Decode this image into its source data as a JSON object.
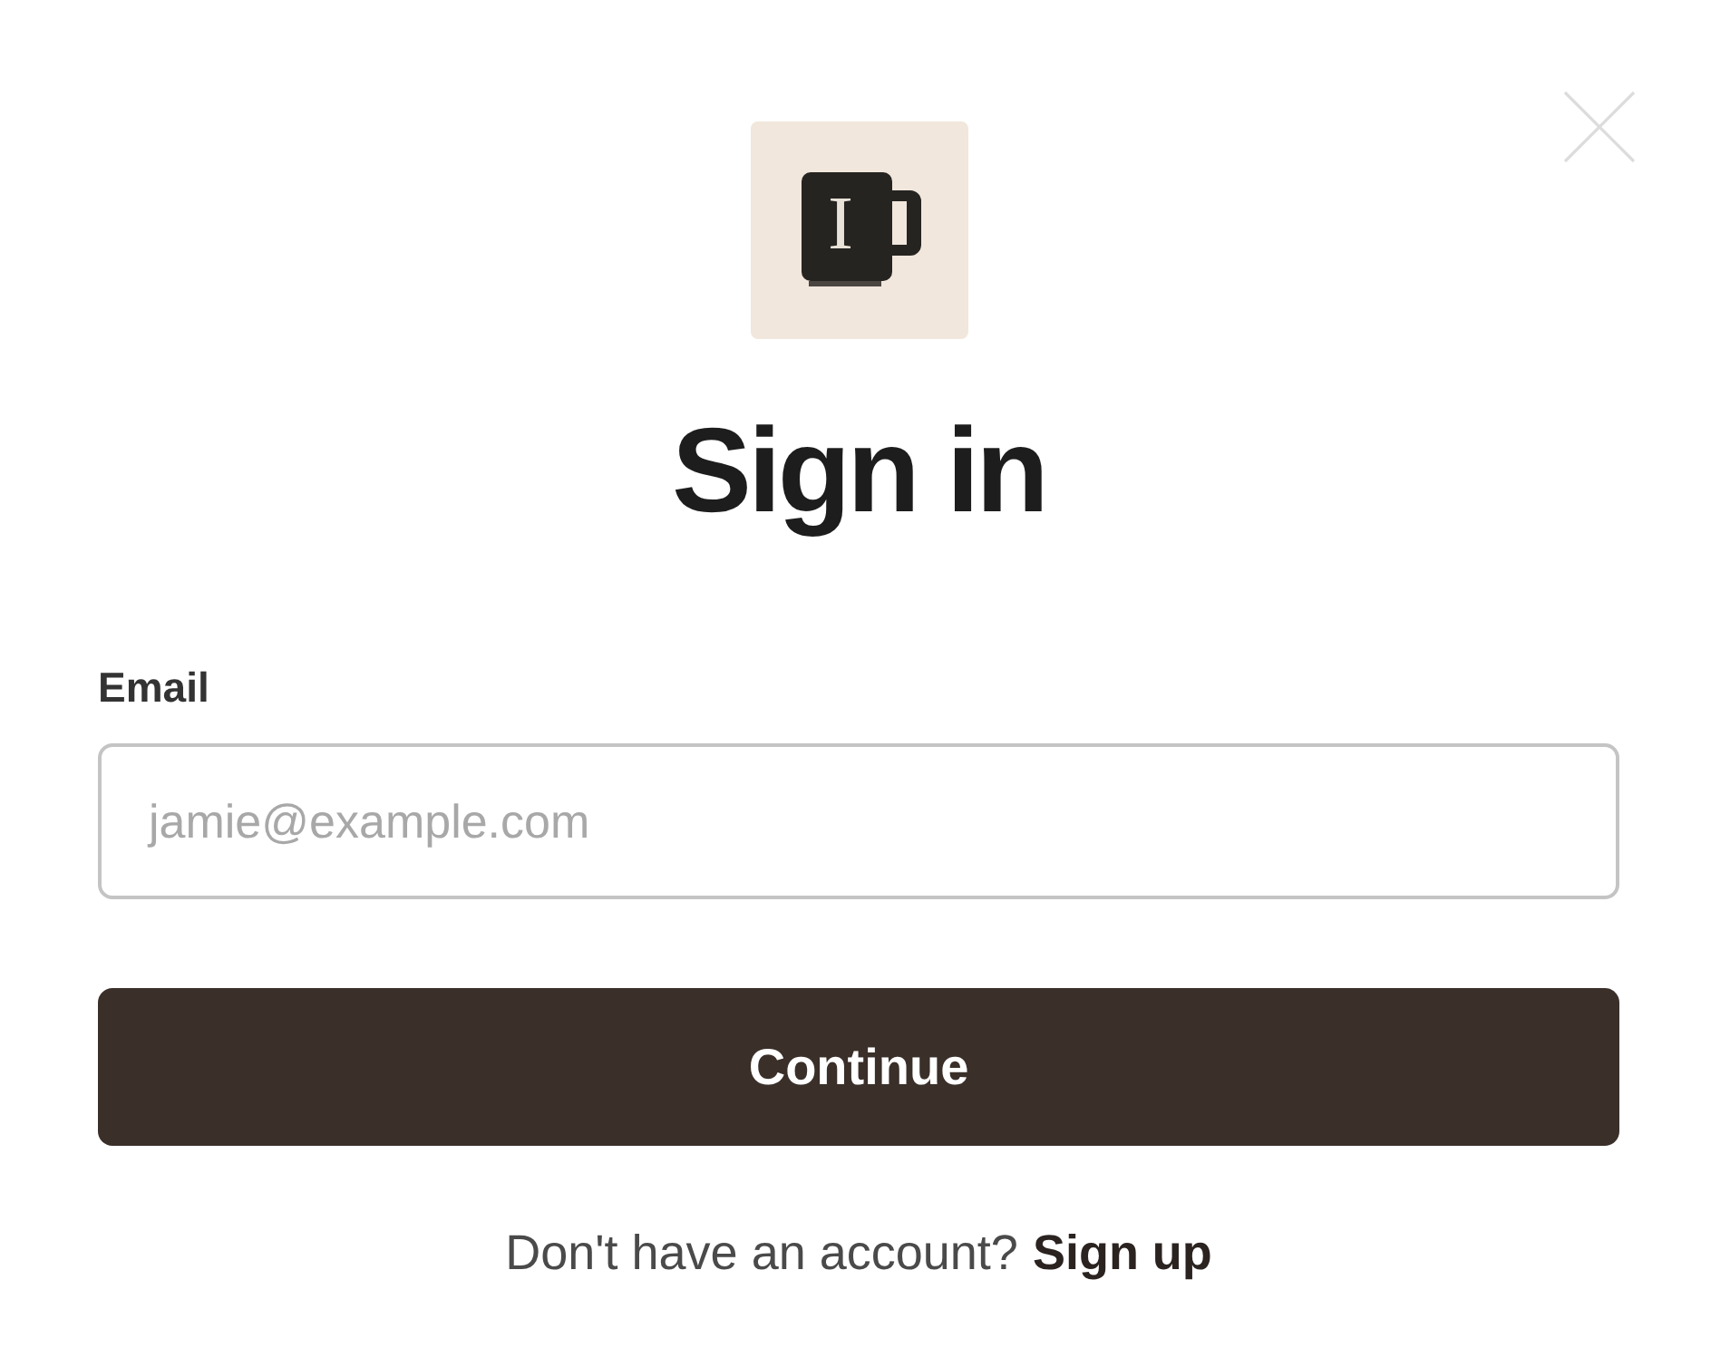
{
  "logo": {
    "letter": "I"
  },
  "title": "Sign in",
  "email_field": {
    "label": "Email",
    "placeholder": "jamie@example.com"
  },
  "continue_button": {
    "label": "Continue"
  },
  "footer": {
    "prompt": "Don't have an account?",
    "link": "Sign up"
  }
}
